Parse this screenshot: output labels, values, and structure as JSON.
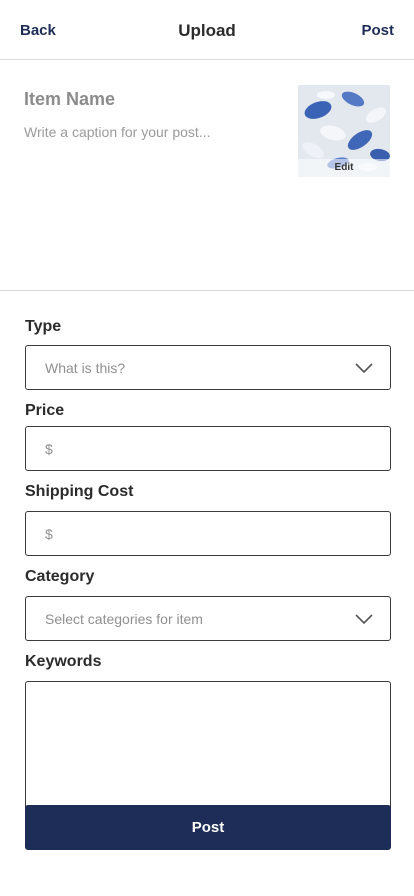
{
  "header": {
    "back_label": "Back",
    "title": "Upload",
    "post_label": "Post"
  },
  "compose": {
    "item_name_placeholder": "Item Name",
    "caption_placeholder": "Write a caption for your post...",
    "thumbnail_edit_label": "Edit"
  },
  "form": {
    "type": {
      "label": "Type",
      "placeholder": "What is this?",
      "icon": "chevron-down-icon"
    },
    "price": {
      "label": "Price",
      "placeholder": "$"
    },
    "shipping": {
      "label": "Shipping Cost",
      "placeholder": "$"
    },
    "category": {
      "label": "Category",
      "placeholder": "Select categories for item",
      "icon": "chevron-down-icon"
    },
    "keywords": {
      "label": "Keywords",
      "value": ""
    }
  },
  "submit": {
    "label": "Post"
  },
  "colors": {
    "accent": "#1d2d57",
    "border": "#3a3a3a",
    "placeholder": "#8f8f8f"
  }
}
